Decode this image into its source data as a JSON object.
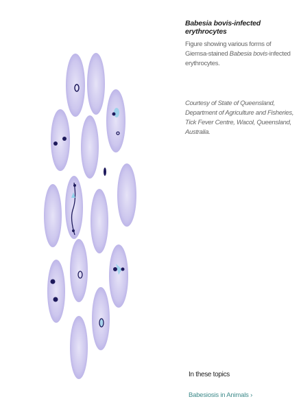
{
  "figure": {
    "title_italic": "Babesia bovis",
    "title_rest": "-infected erythrocytes",
    "description_prefix": "Figure showing various forms of Giemsa-stained ",
    "description_italic": "Babesia bovis",
    "description_suffix": "-infected erythrocytes.",
    "credit": "Courtesy of State of Queensland, Department of Agriculture and Fisheries, Tick Fever Centre, Wacol, Queensland, Australia."
  },
  "topics": {
    "heading": "In these topics",
    "links": [
      {
        "label": "Babesiosis in Animals ›"
      }
    ]
  },
  "colors": {
    "cell_fill": "#c9c4ea",
    "cell_edge": "#a8a0dd",
    "parasite": "#1e1a5c",
    "link": "#3d8a8a"
  }
}
